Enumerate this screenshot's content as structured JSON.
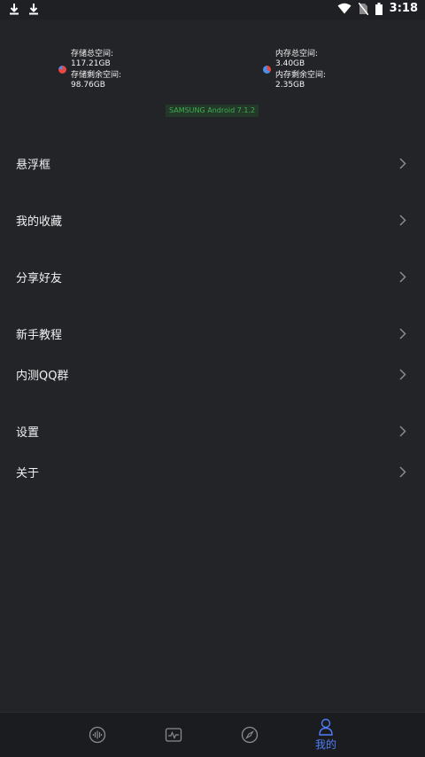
{
  "status_bar": {
    "time": "3:18",
    "left_icons": [
      "download-icon",
      "download-icon"
    ],
    "right_icons": [
      "wifi-icon",
      "no-sim-icon",
      "battery-icon"
    ]
  },
  "header": {
    "storage": {
      "total_label": "存储总空间:",
      "total_value": "117.21GB",
      "free_label": "存储剩余空间:",
      "free_value": "98.76GB"
    },
    "memory": {
      "total_label": "内存总空间:",
      "total_value": "3.40GB",
      "free_label": "内存剩余空间:",
      "free_value": "2.35GB"
    },
    "device": "SAMSUNG Android 7.1.2"
  },
  "menu": {
    "items": [
      {
        "label": "悬浮框"
      },
      {
        "label": "我的收藏"
      },
      {
        "label": "分享好友"
      },
      {
        "label": "新手教程"
      },
      {
        "label": "内测QQ群"
      },
      {
        "label": "设置"
      },
      {
        "label": "关于"
      }
    ]
  },
  "bottom_nav": {
    "tabs": [
      {
        "icon": "audio-wave-icon",
        "label": ""
      },
      {
        "icon": "monitor-chart-icon",
        "label": ""
      },
      {
        "icon": "compass-icon",
        "label": ""
      },
      {
        "icon": "profile-icon",
        "label": "我的"
      }
    ],
    "active_color": "#4f7ef7",
    "inactive_color": "#8a8b8f"
  }
}
